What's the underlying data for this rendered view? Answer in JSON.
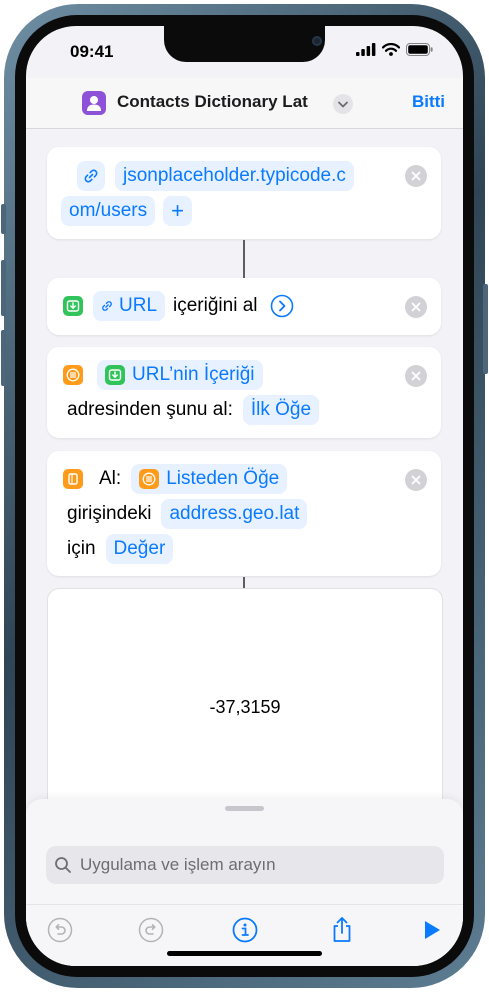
{
  "status_bar": {
    "time": "09:41"
  },
  "nav": {
    "title": "Contacts Dictionary Lat",
    "done_label": "Bitti"
  },
  "actions": {
    "url_action": {
      "url_line1": "jsonplaceholder.typicode.c",
      "url_line2": "om/users",
      "add_symbol": "+"
    },
    "get_contents": {
      "token": "URL",
      "label": "içeriğini al"
    },
    "get_item": {
      "token": "URL’nin İçeriği",
      "label": "adresinden şunu al:",
      "item_token": "İlk Öğe"
    },
    "get_value": {
      "label": "Al:",
      "list_token": "Listeden Öğe",
      "key_label": "girişindeki",
      "key_token": "address.geo.lat",
      "for_label": "için",
      "value_token": "Değer"
    }
  },
  "result": {
    "value": "-37,3159"
  },
  "bottom": {
    "search_placeholder": "Uygulama ve işlem arayın"
  },
  "icons": {
    "link": "link-icon",
    "download": "download-icon",
    "list": "list-icon",
    "dictionary": "dictionary-icon",
    "undo": "undo-icon",
    "redo": "redo-icon",
    "info": "info-icon",
    "share": "share-icon",
    "play": "play-icon"
  },
  "colors": {
    "accent": "#0a7aff",
    "green": "#30c45a",
    "orange": "#ff9b1a",
    "app_icon": "#8e52d8"
  }
}
